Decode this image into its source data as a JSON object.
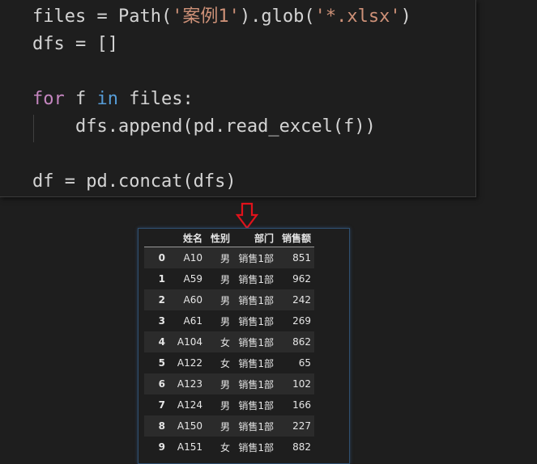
{
  "code": {
    "line1": {
      "prefix": "files = Path(",
      "string1": "'案例1'",
      "middle": ").glob(",
      "string2": "'*.xlsx'",
      "suffix": ")"
    },
    "line2": "dfs = []",
    "line4": {
      "kw_for": "for",
      "var": " f ",
      "kw_in": "in",
      "rest": " files:"
    },
    "line5": "    dfs.append(pd.read_excel(f))",
    "line7": "df = pd.concat(dfs)"
  },
  "colors": {
    "string": "#ce9178",
    "keyword_control": "#c586c0",
    "keyword": "#569cd6",
    "default_text": "#d4d4d4",
    "arrow": "#e0121b"
  },
  "arrow_icon": "down-arrow-icon",
  "dataframe": {
    "columns": [
      "",
      "姓名",
      "性别",
      "部门",
      "销售额"
    ],
    "rows": [
      [
        "0",
        "A10",
        "男",
        "销售1部",
        "851"
      ],
      [
        "1",
        "A59",
        "男",
        "销售1部",
        "962"
      ],
      [
        "2",
        "A60",
        "男",
        "销售1部",
        "242"
      ],
      [
        "3",
        "A61",
        "男",
        "销售1部",
        "269"
      ],
      [
        "4",
        "A104",
        "女",
        "销售1部",
        "862"
      ],
      [
        "5",
        "A122",
        "女",
        "销售1部",
        "65"
      ],
      [
        "6",
        "A123",
        "男",
        "销售1部",
        "102"
      ],
      [
        "7",
        "A124",
        "男",
        "销售1部",
        "166"
      ],
      [
        "8",
        "A150",
        "男",
        "销售1部",
        "227"
      ],
      [
        "9",
        "A151",
        "女",
        "销售1部",
        "882"
      ]
    ]
  }
}
